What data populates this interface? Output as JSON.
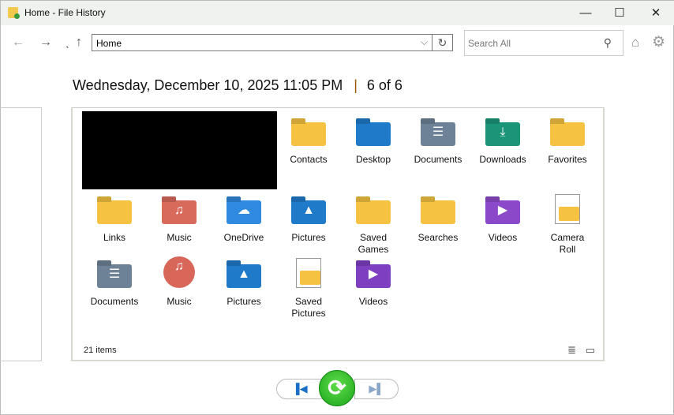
{
  "window": {
    "title": "Home - File History",
    "min": "—",
    "max": "☐",
    "close": "✕"
  },
  "toolbar": {
    "back": "←",
    "forward": "→",
    "recent": "ˎ",
    "up": "↑",
    "address": "Home",
    "refresh": "↻",
    "search_placeholder": "Search All",
    "search_icon": "⚲",
    "home": "⌂",
    "settings": "⚙"
  },
  "header": {
    "date": "Wednesday, December 10, 2025 11:05 PM",
    "sep": "|",
    "position": "6 of 6"
  },
  "items": [
    {
      "label": "Contacts",
      "icon": "folder",
      "color": "#f5c242",
      "glyph": ""
    },
    {
      "label": "Desktop",
      "icon": "folder",
      "color": "#1f7ac9",
      "glyph": ""
    },
    {
      "label": "Documents",
      "icon": "folder",
      "color": "#6d8197",
      "glyph": "☰"
    },
    {
      "label": "Downloads",
      "icon": "folder",
      "color": "#1a9577",
      "glyph": "⤓"
    },
    {
      "label": "Favorites",
      "icon": "folder",
      "color": "#f5c242",
      "glyph": ""
    },
    {
      "label": "Links",
      "icon": "folder",
      "color": "#f5c242",
      "glyph": ""
    },
    {
      "label": "Music",
      "icon": "folder",
      "color": "#d86a5c",
      "glyph": "♫"
    },
    {
      "label": "OneDrive",
      "icon": "folder",
      "color": "#2f8ae0",
      "glyph": "☁"
    },
    {
      "label": "Pictures",
      "icon": "folder",
      "color": "#1f7ac9",
      "glyph": "▲"
    },
    {
      "label": "Saved Games",
      "icon": "folder",
      "color": "#f5c242",
      "glyph": ""
    },
    {
      "label": "Searches",
      "icon": "folder",
      "color": "#f5c242",
      "glyph": ""
    },
    {
      "label": "Videos",
      "icon": "folder",
      "color": "#8b48c9",
      "glyph": "▶"
    },
    {
      "label": "Camera Roll",
      "icon": "doc",
      "color": "#f5c242",
      "glyph": ""
    },
    {
      "label": "Documents",
      "icon": "folder",
      "color": "#6d8197",
      "glyph": "☰"
    },
    {
      "label": "Music",
      "icon": "round",
      "color": "#d8675a",
      "glyph": "♫"
    },
    {
      "label": "Pictures",
      "icon": "folder",
      "color": "#1f7ac9",
      "glyph": "▲"
    },
    {
      "label": "Saved Pictures",
      "icon": "doc",
      "color": "#f5c242",
      "glyph": ""
    },
    {
      "label": "Videos",
      "icon": "folder",
      "color": "#7e3fc0",
      "glyph": "▶"
    }
  ],
  "status": {
    "count": "21 items",
    "details_view": "≣",
    "tiles_view": "▭"
  },
  "controls": {
    "previous": "▐◀",
    "restore": "⟳",
    "next": "▶▌"
  }
}
